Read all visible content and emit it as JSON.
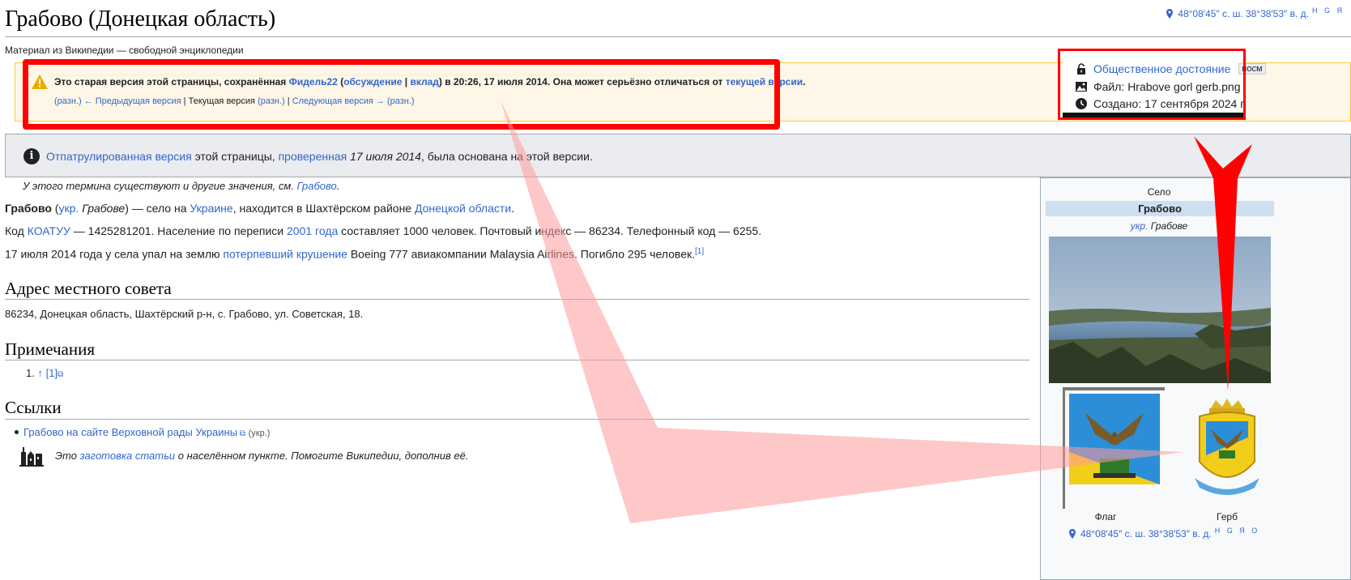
{
  "page": {
    "title": "Грабово (Донецкая область)",
    "tagline": "Материал из Википедии — свободной энциклопедии",
    "coords": "48°08′45″ с. ш. 38°38′53″ в. д.",
    "coords_links": "H G Я",
    "coords_links_bottom": "H G Я O"
  },
  "old_revision": {
    "prefix": "Это старая версия этой страницы, сохранённая ",
    "user": "Фидель22",
    "open_paren": " (",
    "talk": "обсуждение",
    "sep": " | ",
    "contrib": "вклад",
    "suffix": ") в 20:26, 17 июля 2014. Она может серьёзно отличаться от ",
    "current": "текущей версии",
    "dot": ".",
    "diff1": "(разн.)",
    "prev": "← Предыдущая версия",
    "bar1": " | ",
    "cur_label": "Текущая версия",
    "diff2": "(разн.)",
    "bar2": " | ",
    "next": "Следующая версия →",
    "diff3": "(разн.)"
  },
  "patrol": {
    "link1": "Отпатрулированная версия",
    "text1": " этой страницы, ",
    "link2": "проверенная",
    "date": " 17 июля 2014",
    "text2": ", была основана на этой версии."
  },
  "popup": {
    "license": "Общественное достояние",
    "badge": "посм",
    "file": "Файл: Hrabove gorl gerb.png",
    "created": "Создано: 17 сентября 2024 г."
  },
  "article": {
    "hatnote_pre": "У этого термина существуют и другие значения, см. ",
    "hatnote_link": "Грабово",
    "hatnote_post": ".",
    "p1_bold": "Грабово",
    "p1_a": " (",
    "p1_ukr": "укр.",
    "p1_b": " ",
    "p1_native": "Грабове",
    "p1_c": ") — село на ",
    "p1_link1": "Украине",
    "p1_d": ", находится в Шахтёрском районе ",
    "p1_link2": "Донецкой области",
    "p1_e": ".",
    "p2_a": "Код ",
    "p2_link1": "КОАТУУ",
    "p2_b": " — 1425281201. Население по переписи ",
    "p2_link2": "2001 года",
    "p2_c": " составляет 1000 человек. Почтовый индекс — 86234. Телефонный код — 6255.",
    "p3_a": "17 июля 2014 года у села упал на землю ",
    "p3_link1": "потерпевший крушение",
    "p3_b": " Boeing 777 авиакомпании Malaysia Airlines. Погибло 295 человек.",
    "p3_ref": "[1]",
    "h_address": "Адрес местного совета",
    "address": "86234, Донецкая область, Шахтёрский р-н, с. Грабово, ул. Советская, 18.",
    "h_notes": "Примечания",
    "note1_num": "1. ",
    "note1_arrow": "↑",
    "note1_ref": " [1]",
    "h_links": "Ссылки",
    "link1": "Грабово на сайте Верховной рады Украины",
    "link1_lang": "(укр.)",
    "stub_a": "Это ",
    "stub_link": "заготовка статьи",
    "stub_b": " о населённом пункте. Помогите Википедии, дополнив её."
  },
  "infobox": {
    "type": "Село",
    "name": "Грабово",
    "native_lang": "укр.",
    "native_name": "Грабове",
    "flag_caption": "Флаг",
    "coat_caption": "Герб"
  },
  "colors": {
    "link": "#3366cc",
    "annotation_red": "#ff0000",
    "old_rev_bg": "#fef6e7",
    "patrol_bg": "#eaecf0"
  }
}
